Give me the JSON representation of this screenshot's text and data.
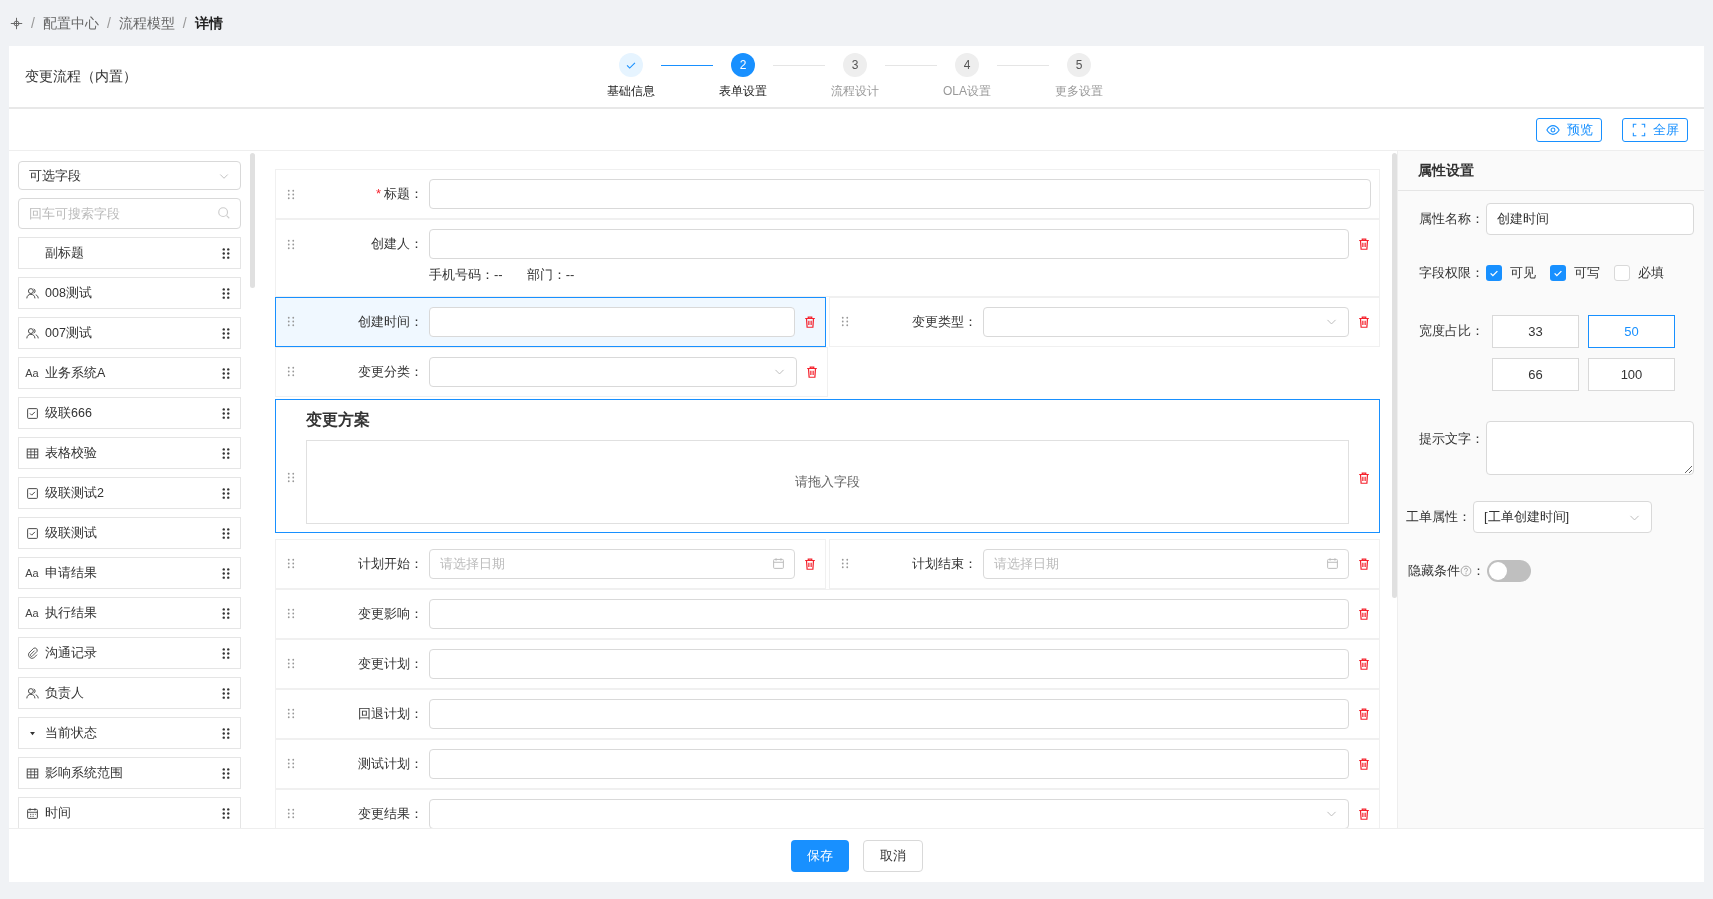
{
  "breadcrumb": [
    {
      "label": "配置中心"
    },
    {
      "label": "流程模型"
    },
    {
      "label": "详情",
      "current": true
    }
  ],
  "breadcrumb_separator": "/",
  "header": {
    "title": "变更流程（内置）",
    "steps": [
      {
        "label": "基础信息",
        "completed": true,
        "selected": false
      },
      {
        "number": "2",
        "label": "表单设置",
        "completed": false,
        "selected": true
      },
      {
        "number": "3",
        "label": "流程设计",
        "completed": false,
        "selected": false
      },
      {
        "number": "4",
        "label": "OLA设置",
        "completed": false,
        "selected": false
      },
      {
        "number": "5",
        "label": "更多设置",
        "completed": false,
        "selected": false
      }
    ]
  },
  "toolbar": [
    {
      "label": "预览",
      "kind": "eye"
    },
    {
      "label": "全屏",
      "kind": "expand"
    }
  ],
  "sidebar": {
    "dropdown": "可选字段",
    "search_placeholder": "回车可搜索字段",
    "items": [
      {
        "label": "副标题",
        "kind": "none"
      },
      {
        "label": "008测试",
        "kind": "user"
      },
      {
        "label": "007测试",
        "kind": "user"
      },
      {
        "label": "业务系统A",
        "kind": "text",
        "glyph": "Aa"
      },
      {
        "label": "级联666",
        "kind": "checkbox"
      },
      {
        "label": "表格校验",
        "kind": "table"
      },
      {
        "label": "级联测试2",
        "kind": "checkbox"
      },
      {
        "label": "级联测试",
        "kind": "checkbox"
      },
      {
        "label": "申请结果",
        "kind": "text",
        "glyph": "Aa"
      },
      {
        "label": "执行结果",
        "kind": "text",
        "glyph": "Aa"
      },
      {
        "label": "沟通记录",
        "kind": "link"
      },
      {
        "label": "负责人",
        "kind": "user"
      },
      {
        "label": "当前状态",
        "kind": "select"
      },
      {
        "label": "影响系统范围",
        "kind": "table"
      },
      {
        "label": "时间",
        "kind": "calendar"
      }
    ]
  },
  "form": [
    {
      "kind": "full",
      "fields": [
        {
          "label": "标题：",
          "mark": "*",
          "kind": "input",
          "deletable": false,
          "selected": false
        }
      ]
    },
    {
      "kind": "full",
      "fields": [
        {
          "label": "创建人：",
          "kind": "input",
          "deletable": true,
          "selected": false,
          "info": [
            "手机号码：--",
            "部门：--"
          ]
        }
      ]
    },
    {
      "kind": "half",
      "fields": [
        {
          "label": "创建时间：",
          "kind": "input",
          "deletable": true,
          "selected": true
        },
        {
          "label": "变更类型：",
          "kind": "select",
          "deletable": true,
          "selected": false
        }
      ]
    },
    {
      "kind": "half",
      "fields": [
        {
          "label": "变更分类：",
          "kind": "select",
          "deletable": true,
          "selected": false
        }
      ]
    },
    {
      "kind": "section",
      "title": "变更方案",
      "drop_text": "请拖入字段",
      "deletable": true,
      "selected": true
    },
    {
      "kind": "half",
      "fields": [
        {
          "label": "计划开始：",
          "kind": "date",
          "placeholder": "请选择日期",
          "deletable": true,
          "selected": false
        },
        {
          "label": "计划结束：",
          "kind": "date",
          "placeholder": "请选择日期",
          "deletable": true,
          "selected": false
        }
      ]
    },
    {
      "kind": "full",
      "fields": [
        {
          "label": "变更影响：",
          "kind": "input",
          "deletable": true,
          "selected": false
        }
      ]
    },
    {
      "kind": "full",
      "fields": [
        {
          "label": "变更计划：",
          "kind": "input",
          "deletable": true,
          "selected": false
        }
      ]
    },
    {
      "kind": "full",
      "fields": [
        {
          "label": "回退计划：",
          "kind": "input",
          "deletable": true,
          "selected": false
        }
      ]
    },
    {
      "kind": "full",
      "fields": [
        {
          "label": "测试计划：",
          "kind": "input",
          "deletable": true,
          "selected": false
        }
      ]
    },
    {
      "kind": "full",
      "fields": [
        {
          "label": "变更结果：",
          "kind": "select",
          "deletable": true,
          "selected": false
        }
      ]
    }
  ],
  "properties": {
    "title": "属性设置",
    "name": {
      "label": "属性名称：",
      "value": "创建时间"
    },
    "permissions": {
      "label": "字段权限：",
      "options": [
        {
          "label": "可见",
          "checked": true
        },
        {
          "label": "可写",
          "checked": true
        },
        {
          "label": "必填",
          "checked": false
        }
      ]
    },
    "width": {
      "label": "宽度占比：",
      "options": [
        {
          "label": "33",
          "selected": false
        },
        {
          "label": "50",
          "selected": true
        },
        {
          "label": "66",
          "selected": false
        },
        {
          "label": "100",
          "selected": false
        }
      ]
    },
    "hint": {
      "label": "提示文字："
    },
    "ticket_attr": {
      "label": "工单属性：",
      "value": "[工单创建时间]"
    },
    "hidden": {
      "label": "隐藏条件",
      "colon": "：",
      "on": false
    }
  },
  "footer": [
    {
      "label": "保存",
      "primary": true
    },
    {
      "label": "取消",
      "primary": false
    }
  ]
}
